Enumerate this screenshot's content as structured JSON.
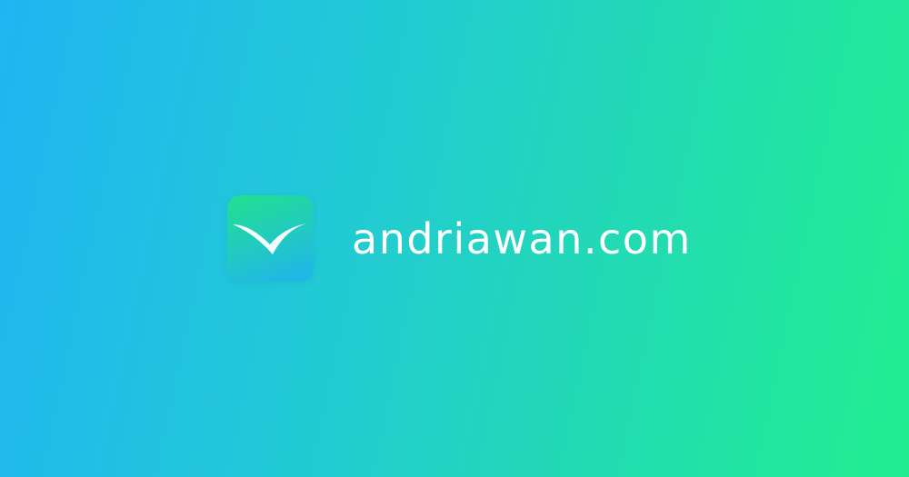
{
  "brand": {
    "name": "andriawan.com",
    "logo_icon": "checkmark-bird-icon",
    "text_color": "#ffffff"
  },
  "colors": {
    "gradient_start": "#1fb5f2",
    "gradient_end": "#22ee90",
    "logo_gradient_top": "#22e08e",
    "logo_gradient_bottom": "#1fb3ee"
  }
}
